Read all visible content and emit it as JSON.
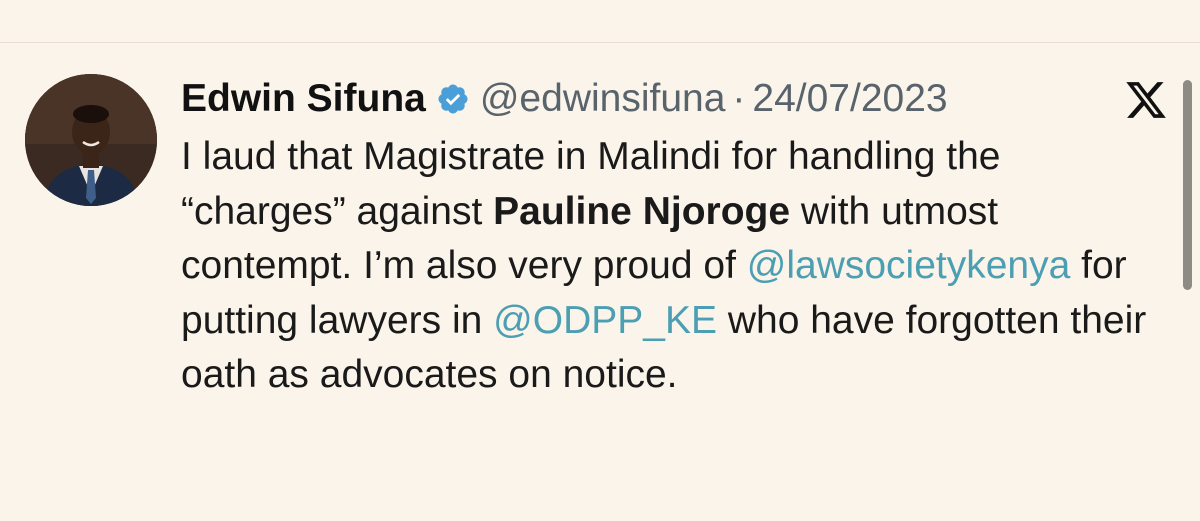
{
  "tweet": {
    "author_name": "Edwin Sifuna",
    "handle": "@edwinsifuna",
    "separator": "·",
    "date": "24/07/2023",
    "verified_icon": "verified-badge-icon",
    "platform_icon": "x-logo-icon",
    "body": {
      "part1": "I laud that Magistrate in Malindi for handling the “charges” against ",
      "bold_name": "Pauline Njoroge",
      "part2": " with utmost contempt. I’m also very proud of ",
      "mention1": "@lawsocietykenya",
      "part3": " for putting lawyers in ",
      "mention2": "@ODPP_KE",
      "part4": " who have forgotten their oath as advocates on notice."
    }
  },
  "colors": {
    "background": "#faf4ea",
    "mention": "#4c9fb2",
    "verified": "#4a9fd8",
    "muted": "#59636b"
  }
}
